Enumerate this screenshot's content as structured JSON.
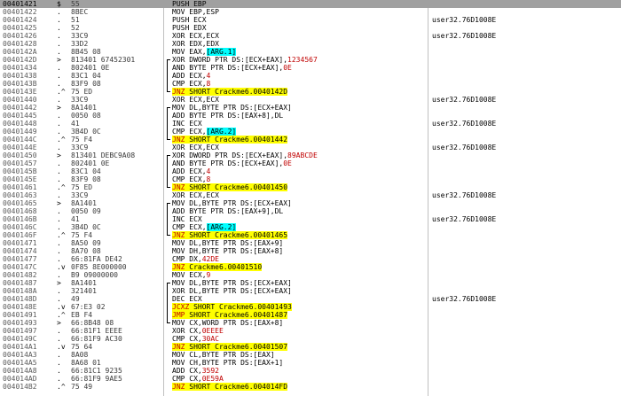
{
  "colors": {
    "selection": "#a0a0a0",
    "jump_highlight": "#ffff00",
    "arg_highlight": "#00ffff",
    "red_text": "#c00000"
  },
  "rows": [
    {
      "addr": "00401421",
      "mark": "$",
      "hex": "55",
      "asm": [
        {
          "t": "PUSH EBP"
        }
      ],
      "cmt": "",
      "sel": true
    },
    {
      "addr": "00401422",
      "mark": ".",
      "hex": "8BEC",
      "asm": [
        {
          "t": "MOV EBP,ESP"
        }
      ],
      "cmt": ""
    },
    {
      "addr": "00401424",
      "mark": ".",
      "hex": "51",
      "asm": [
        {
          "t": "PUSH ECX"
        }
      ],
      "cmt": "user32.76D1008E"
    },
    {
      "addr": "00401425",
      "mark": ".",
      "hex": "52",
      "asm": [
        {
          "t": "PUSH EDX"
        }
      ],
      "cmt": ""
    },
    {
      "addr": "00401426",
      "mark": ".",
      "hex": "33C9",
      "asm": [
        {
          "t": "XOR ECX,ECX"
        }
      ],
      "cmt": "user32.76D1008E"
    },
    {
      "addr": "00401428",
      "mark": ".",
      "hex": "33D2",
      "asm": [
        {
          "t": "XOR EDX,EDX"
        }
      ],
      "cmt": ""
    },
    {
      "addr": "0040142A",
      "mark": ".",
      "hex": "8B45 08",
      "asm": [
        {
          "t": "MOV EAX,"
        },
        {
          "t": "[ARG.1]",
          "c": "arg"
        }
      ],
      "cmt": ""
    },
    {
      "addr": "0040142D",
      "mark": ">",
      "hex": "813401 67452301",
      "asm": [
        {
          "t": "XOR DWORD PTR DS:[ECX+EAX],"
        },
        {
          "t": "1234567",
          "c": "red"
        }
      ],
      "cmt": ""
    },
    {
      "addr": "00401434",
      "mark": ".",
      "hex": "802401 0E",
      "asm": [
        {
          "t": "AND BYTE PTR DS:[ECX+EAX],"
        },
        {
          "t": "0E",
          "c": "red"
        }
      ],
      "cmt": ""
    },
    {
      "addr": "00401438",
      "mark": ".",
      "hex": "83C1 04",
      "asm": [
        {
          "t": "ADD ECX,"
        },
        {
          "t": "4",
          "c": "red"
        }
      ],
      "cmt": ""
    },
    {
      "addr": "0040143B",
      "mark": ".",
      "hex": "83F9 08",
      "asm": [
        {
          "t": "CMP ECX,"
        },
        {
          "t": "8",
          "c": "red"
        }
      ],
      "cmt": ""
    },
    {
      "addr": "0040143E",
      "mark": ".^",
      "hex": "75 ED",
      "asm": [
        {
          "t": "JNZ",
          "c": "jmpred"
        },
        {
          "t": " SHORT Crackme6.0040142D",
          "c": "jmp"
        }
      ],
      "cmt": ""
    },
    {
      "addr": "00401440",
      "mark": ".",
      "hex": "33C9",
      "asm": [
        {
          "t": "XOR ECX,ECX"
        }
      ],
      "cmt": "user32.76D1008E"
    },
    {
      "addr": "00401442",
      "mark": ">",
      "hex": "8A1401",
      "asm": [
        {
          "t": "MOV DL,BYTE PTR DS:[ECX+EAX]"
        }
      ],
      "cmt": ""
    },
    {
      "addr": "00401445",
      "mark": ".",
      "hex": "0050 08",
      "asm": [
        {
          "t": "ADD BYTE PTR DS:[EAX+8],DL"
        }
      ],
      "cmt": ""
    },
    {
      "addr": "00401448",
      "mark": ".",
      "hex": "41",
      "asm": [
        {
          "t": "INC ECX"
        }
      ],
      "cmt": "user32.76D1008E"
    },
    {
      "addr": "00401449",
      "mark": ".",
      "hex": "3B4D 0C",
      "asm": [
        {
          "t": "CMP ECX,"
        },
        {
          "t": "[ARG.2]",
          "c": "arg"
        }
      ],
      "cmt": ""
    },
    {
      "addr": "0040144C",
      "mark": ".^",
      "hex": "75 F4",
      "asm": [
        {
          "t": "JNZ",
          "c": "jmpred"
        },
        {
          "t": " SHORT Crackme6.00401442",
          "c": "jmp"
        }
      ],
      "cmt": ""
    },
    {
      "addr": "0040144E",
      "mark": ".",
      "hex": "33C9",
      "asm": [
        {
          "t": "XOR ECX,ECX"
        }
      ],
      "cmt": "user32.76D1008E"
    },
    {
      "addr": "00401450",
      "mark": ">",
      "hex": "813401 DEBC9A08",
      "asm": [
        {
          "t": "XOR DWORD PTR DS:[ECX+EAX],"
        },
        {
          "t": "89ABCDE",
          "c": "red"
        }
      ],
      "cmt": ""
    },
    {
      "addr": "00401457",
      "mark": ".",
      "hex": "802401 0E",
      "asm": [
        {
          "t": "AND BYTE PTR DS:[ECX+EAX],"
        },
        {
          "t": "0E",
          "c": "red"
        }
      ],
      "cmt": ""
    },
    {
      "addr": "0040145B",
      "mark": ".",
      "hex": "83C1 04",
      "asm": [
        {
          "t": "ADD ECX,"
        },
        {
          "t": "4",
          "c": "red"
        }
      ],
      "cmt": ""
    },
    {
      "addr": "0040145E",
      "mark": ".",
      "hex": "83F9 08",
      "asm": [
        {
          "t": "CMP ECX,"
        },
        {
          "t": "8",
          "c": "red"
        }
      ],
      "cmt": ""
    },
    {
      "addr": "00401461",
      "mark": ".^",
      "hex": "75 ED",
      "asm": [
        {
          "t": "JNZ",
          "c": "jmpred"
        },
        {
          "t": " SHORT Crackme6.00401450",
          "c": "jmp"
        }
      ],
      "cmt": ""
    },
    {
      "addr": "00401463",
      "mark": ".",
      "hex": "33C9",
      "asm": [
        {
          "t": "XOR ECX,ECX"
        }
      ],
      "cmt": "user32.76D1008E"
    },
    {
      "addr": "00401465",
      "mark": ">",
      "hex": "8A1401",
      "asm": [
        {
          "t": "MOV DL,BYTE PTR DS:[ECX+EAX]"
        }
      ],
      "cmt": ""
    },
    {
      "addr": "00401468",
      "mark": ".",
      "hex": "0050 09",
      "asm": [
        {
          "t": "ADD BYTE PTR DS:[EAX+9],DL"
        }
      ],
      "cmt": ""
    },
    {
      "addr": "0040146B",
      "mark": ".",
      "hex": "41",
      "asm": [
        {
          "t": "INC ECX"
        }
      ],
      "cmt": "user32.76D1008E"
    },
    {
      "addr": "0040146C",
      "mark": ".",
      "hex": "3B4D 0C",
      "asm": [
        {
          "t": "CMP ECX,"
        },
        {
          "t": "[ARG.2]",
          "c": "arg"
        }
      ],
      "cmt": ""
    },
    {
      "addr": "0040146F",
      "mark": ".^",
      "hex": "75 F4",
      "asm": [
        {
          "t": "JNZ",
          "c": "jmpred"
        },
        {
          "t": " SHORT Crackme6.00401465",
          "c": "jmp"
        }
      ],
      "cmt": ""
    },
    {
      "addr": "00401471",
      "mark": ".",
      "hex": "8A50 09",
      "asm": [
        {
          "t": "MOV DL,BYTE PTR DS:[EAX+9]"
        }
      ],
      "cmt": ""
    },
    {
      "addr": "00401474",
      "mark": ".",
      "hex": "8A70 08",
      "asm": [
        {
          "t": "MOV DH,BYTE PTR DS:[EAX+8]"
        }
      ],
      "cmt": ""
    },
    {
      "addr": "00401477",
      "mark": ".",
      "hex": "66:81FA DE42",
      "asm": [
        {
          "t": "CMP DX,"
        },
        {
          "t": "42DE",
          "c": "red"
        }
      ],
      "cmt": ""
    },
    {
      "addr": "0040147C",
      "mark": ".v",
      "hex": "0F85 8E000000",
      "asm": [
        {
          "t": "JNZ",
          "c": "jmpred"
        },
        {
          "t": " Crackme6.00401510",
          "c": "jmp"
        }
      ],
      "cmt": ""
    },
    {
      "addr": "00401482",
      "mark": ".",
      "hex": "B9 09000000",
      "asm": [
        {
          "t": "MOV ECX,"
        },
        {
          "t": "9",
          "c": "red"
        }
      ],
      "cmt": ""
    },
    {
      "addr": "00401487",
      "mark": ">",
      "hex": "8A1401",
      "asm": [
        {
          "t": "MOV DL,BYTE PTR DS:[ECX+EAX]"
        }
      ],
      "cmt": ""
    },
    {
      "addr": "0040148A",
      "mark": ".",
      "hex": "321401",
      "asm": [
        {
          "t": "XOR DL,BYTE PTR DS:[ECX+EAX]"
        }
      ],
      "cmt": ""
    },
    {
      "addr": "0040148D",
      "mark": ".",
      "hex": "49",
      "asm": [
        {
          "t": "DEC ECX"
        }
      ],
      "cmt": "user32.76D1008E"
    },
    {
      "addr": "0040148E",
      "mark": ".v",
      "hex": "67:E3 02",
      "asm": [
        {
          "t": "JCXZ",
          "c": "jmpred"
        },
        {
          "t": " SHORT Crackme6.00401493",
          "c": "jmp"
        }
      ],
      "cmt": ""
    },
    {
      "addr": "00401491",
      "mark": ".^",
      "hex": "EB F4",
      "asm": [
        {
          "t": "JMP",
          "c": "jmpred"
        },
        {
          "t": " SHORT Crackme6.00401487",
          "c": "jmp"
        }
      ],
      "cmt": ""
    },
    {
      "addr": "00401493",
      "mark": ">",
      "hex": "66:8B48 08",
      "asm": [
        {
          "t": "MOV CX,WORD PTR DS:[EAX+8]"
        }
      ],
      "cmt": ""
    },
    {
      "addr": "00401497",
      "mark": ".",
      "hex": "66:81F1 EEEE",
      "asm": [
        {
          "t": "XOR CX,"
        },
        {
          "t": "0EEEE",
          "c": "red"
        }
      ],
      "cmt": ""
    },
    {
      "addr": "0040149C",
      "mark": ".",
      "hex": "66:81F9 AC30",
      "asm": [
        {
          "t": "CMP CX,"
        },
        {
          "t": "30AC",
          "c": "red"
        }
      ],
      "cmt": ""
    },
    {
      "addr": "004014A1",
      "mark": ".v",
      "hex": "75 64",
      "asm": [
        {
          "t": "JNZ",
          "c": "jmpred"
        },
        {
          "t": " SHORT Crackme6.00401507",
          "c": "jmp"
        }
      ],
      "cmt": ""
    },
    {
      "addr": "004014A3",
      "mark": ".",
      "hex": "8A08",
      "asm": [
        {
          "t": "MOV CL,BYTE PTR DS:[EAX]"
        }
      ],
      "cmt": ""
    },
    {
      "addr": "004014A5",
      "mark": ".",
      "hex": "8A68 01",
      "asm": [
        {
          "t": "MOV CH,BYTE PTR DS:[EAX+1]"
        }
      ],
      "cmt": ""
    },
    {
      "addr": "004014A8",
      "mark": ".",
      "hex": "66:81C1 9235",
      "asm": [
        {
          "t": "ADD CX,"
        },
        {
          "t": "3592",
          "c": "red"
        }
      ],
      "cmt": ""
    },
    {
      "addr": "004014AD",
      "mark": ".",
      "hex": "66:81F9 9AE5",
      "asm": [
        {
          "t": "CMP CX,"
        },
        {
          "t": "0E59A",
          "c": "red"
        }
      ],
      "cmt": ""
    },
    {
      "addr": "004014B2",
      "mark": ".^",
      "hex": "75 49",
      "asm": [
        {
          "t": "JNZ",
          "c": "jmpred"
        },
        {
          "t": " SHORT Crackme6.004014FD",
          "c": "jmp"
        }
      ],
      "cmt": ""
    }
  ]
}
